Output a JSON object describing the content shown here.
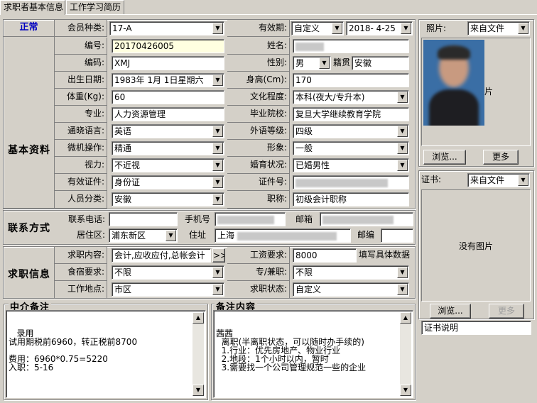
{
  "tabs": [
    "求职者基本信息",
    "工作学习简历"
  ],
  "status": {
    "label": "正常"
  },
  "member": {
    "label": "会员种类:",
    "value": "17-A"
  },
  "validity": {
    "label": "有效期:",
    "mode": "自定义",
    "date": "2018- 4-25"
  },
  "photo": {
    "label": "照片:",
    "source": "来自文件",
    "caption": "片",
    "browse": "浏览...",
    "more": "更多"
  },
  "cert": {
    "label": "证书:",
    "source": "来自文件",
    "empty": "没有图片",
    "browse": "浏览...",
    "more": "更多",
    "note": "证书说明"
  },
  "basic": {
    "section": "基本资料",
    "number_label": "编号:",
    "number": "20170426005",
    "name_label": "姓名:",
    "code_label": "编码:",
    "code": "XMJ",
    "gender_label": "性别:",
    "gender": "男",
    "native_label": "籍贯",
    "native": "安徽",
    "birth_label": "出生日期:",
    "birth": "1983年 1月 1日星期六",
    "height_label": "身高(Cm):",
    "height": "170",
    "weight_label": "体重(Kg):",
    "weight": "60",
    "edu_label": "文化程度:",
    "edu": "本科(夜大/专升本)",
    "major_label": "专业:",
    "major": "人力资源管理",
    "school_label": "毕业院校:",
    "school": "复旦大学继续教育学院",
    "lang_label": "通晓语言:",
    "lang": "英语",
    "lang_level_label": "外语等级:",
    "lang_level": "四级",
    "pc_label": "微机操作:",
    "pc": "精通",
    "image_label": "形象:",
    "image": "一般",
    "vision_label": "视力:",
    "vision": "不近视",
    "marital_label": "婚育状况:",
    "marital": "已婚男性",
    "id_type_label": "有效证件:",
    "id_type": "身份证",
    "id_no_label": "证件号:",
    "category_label": "人员分类:",
    "category": "安徽",
    "title_label": "职称:",
    "title": "初级会计职称"
  },
  "contact": {
    "section": "联系方式",
    "phone_label": "联系电话:",
    "mobile_label": "手机号",
    "email_label": "邮箱",
    "district_label": "居住区:",
    "district": "浦东新区",
    "address_label": "住址",
    "address": "上海",
    "zip_label": "邮编"
  },
  "job": {
    "section": "求职信息",
    "content_label": "求职内容:",
    "content": "会计,应收应付,总帐会计",
    "more_btn": ">>",
    "salary_label": "工资要求:",
    "salary": "8000",
    "salary_hint": "填写具体数据",
    "board_label": "食宿要求:",
    "board": "不限",
    "type_label": "专/兼职:",
    "type": "不限",
    "location_label": "工作地点:",
    "location": "市区",
    "state_label": "求职状态:",
    "state": "自定义"
  },
  "agent_note": {
    "title": "中介备注",
    "text": "   录用\n试用期税前6960，转正税前8700\n\n费用：6960*0.75=5220\n入职：5-16"
  },
  "remark": {
    "title": "备注内容",
    "text": "茜茜\n  离职(半离职状态，可以随时办手续的)\n  1.行业：优先房地产、物业行业\n  2.地段：1个小时以内，暂时\n  3.需要找一个公司管理规范一些的企业"
  }
}
